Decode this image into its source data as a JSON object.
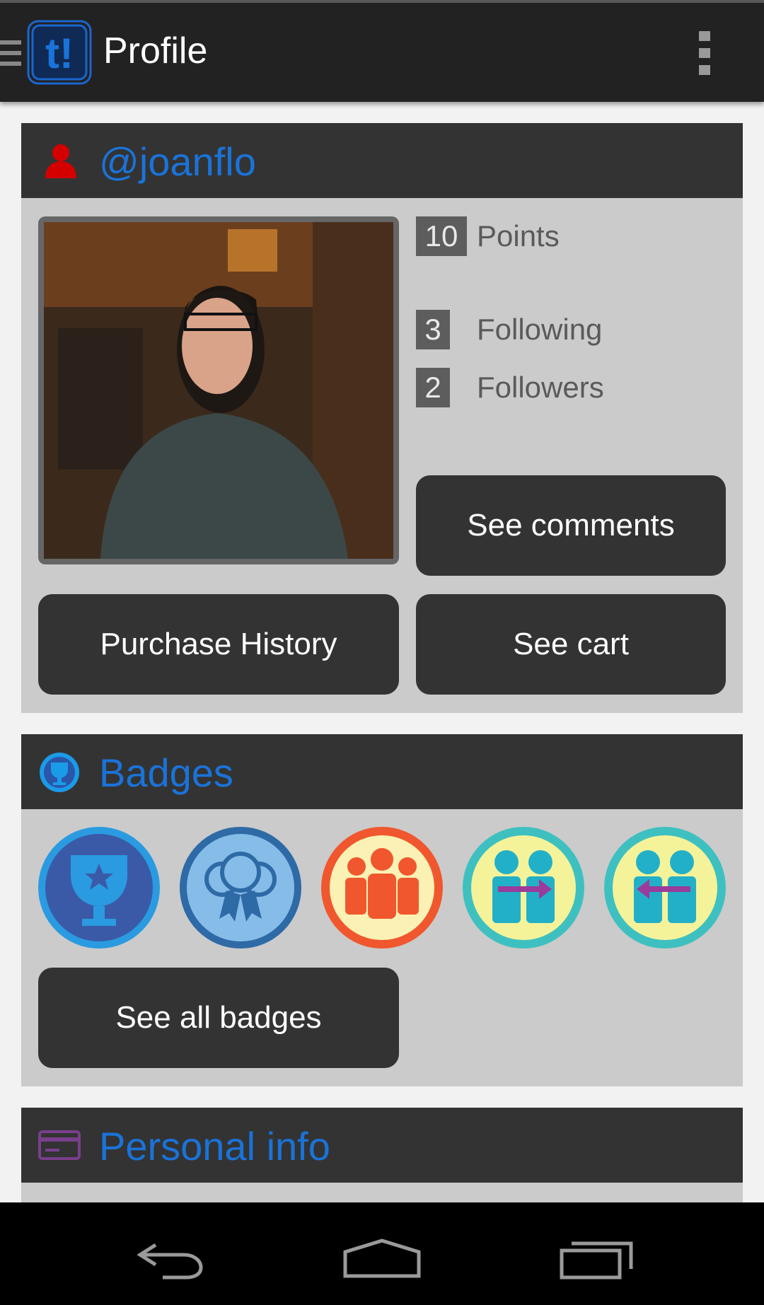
{
  "actionbar": {
    "title": "Profile",
    "logo_text": "t!",
    "icons": [
      "drawer-icon",
      "app-logo",
      "overflow-menu-icon"
    ]
  },
  "profile": {
    "username": "@joanflo",
    "stats": [
      {
        "value": "10",
        "label": "Points"
      },
      {
        "value": "3",
        "label": "Following"
      },
      {
        "value": "2",
        "label": "Followers"
      }
    ],
    "buttons": {
      "comments": "See comments",
      "purchase_history": "Purchase History",
      "cart": "See cart"
    }
  },
  "badges": {
    "title": "Badges",
    "items": [
      "trophy-badge",
      "ribbons-badge",
      "group-badge",
      "following-badge",
      "followers-badge"
    ],
    "see_all": "See all badges"
  },
  "personal_info": {
    "title": "Personal info"
  },
  "colors": {
    "accent": "#1a73d9",
    "header_bg": "#333333",
    "card_bg": "#cbcbcb",
    "user_icon": "#d40000",
    "info_icon": "#7a3f8c"
  }
}
